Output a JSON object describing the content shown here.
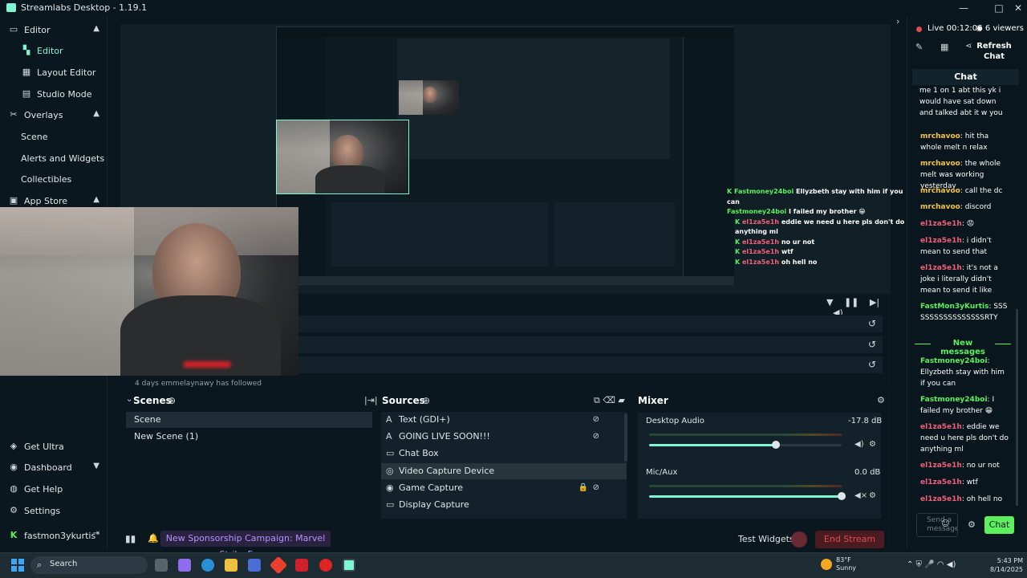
{
  "window": {
    "title": "Streamlabs Desktop - 1.19.1"
  },
  "sidebar": {
    "sections": [
      {
        "label": "Editor",
        "icon": "editor-icon",
        "children": [
          "Editor",
          "Layout Editor",
          "Studio Mode"
        ]
      },
      {
        "label": "Overlays",
        "icon": "overlays-icon",
        "children": [
          "Scene",
          "Alerts and Widgets",
          "Collectibles"
        ]
      },
      {
        "label": "App Store",
        "icon": "app-store-icon"
      }
    ],
    "bottom": [
      "Get Ultra",
      "Dashboard",
      "Get Help",
      "Settings"
    ],
    "user": "fastmon3ykurtis"
  },
  "events": {
    "follow_text": "4 days   emmelaynawy   has followed"
  },
  "scenes": {
    "title": "Scenes",
    "items": [
      "Scene",
      "New Scene (1)"
    ]
  },
  "sources": {
    "title": "Sources",
    "items": [
      "Text (GDI+)",
      "GOING LIVE SOON!!!",
      "Chat Box",
      "Video Capture Device",
      "Game Capture",
      "Display Capture"
    ]
  },
  "mixer": {
    "title": "Mixer",
    "channels": [
      {
        "name": "Desktop Audio",
        "db": "-17.8 dB",
        "level": 0.66
      },
      {
        "name": "Mic/Aux",
        "db": "0.0 dB",
        "level": 1.0
      }
    ]
  },
  "bottombar": {
    "promo": "New Sponsorship Campaign: Marvel Strike Force",
    "test_widgets": "Test Widgets",
    "end_stream": "End Stream"
  },
  "live": {
    "status": "Live",
    "time": "00:12:06",
    "viewers": "6 viewers",
    "refresh": "Refresh Chat"
  },
  "chat": {
    "title": "Chat",
    "cut_top": "me 1 on 1 abt this yk i would have sat down and talked abt it w you",
    "messages": [
      {
        "user": "mrchavoo",
        "text": "hit tha whole melt n relax",
        "color": "y"
      },
      {
        "user": "mrchavoo",
        "text": "the whole melt was working yesterday",
        "color": "y"
      },
      {
        "user": "mrchavoo",
        "text": "call the dc",
        "color": "y"
      },
      {
        "user": "mrchavoo",
        "text": "discord",
        "color": "y"
      },
      {
        "user": "el1za5e1h",
        "text": "😡",
        "color": "r"
      },
      {
        "user": "el1za5e1h",
        "text": "i didn't mean to send that",
        "color": "r"
      },
      {
        "user": "el1za5e1h",
        "text": "it's not a joke i literally didn't mean to send it like",
        "color": "r"
      },
      {
        "user": "FastMon3yKurtis",
        "text": "SSSSSSSSSSSSSSSSSRTY",
        "color": "g"
      }
    ],
    "new_label": "New messages",
    "new_messages": [
      {
        "user": "Fastmoney24boi",
        "text": "Ellyzbeth stay with him if you can",
        "color": "g"
      },
      {
        "user": "Fastmoney24boi",
        "text": "I failed my brother 😁",
        "color": "g"
      },
      {
        "user": "el1za5e1h",
        "text": "eddie we need u here pls don't do anything ml",
        "color": "r"
      },
      {
        "user": "el1za5e1h",
        "text": "no ur not",
        "color": "r"
      },
      {
        "user": "el1za5e1h",
        "text": "wtf",
        "color": "r"
      },
      {
        "user": "el1za5e1h",
        "text": "oh hell no",
        "color": "r"
      }
    ],
    "input_placeholder": "Send a message",
    "send": "Chat"
  },
  "overlay_chat": [
    {
      "user": "Fastmoney24boi",
      "text": "Ellyzbeth stay with him if you can"
    },
    {
      "user": "Fastmoney24boi",
      "text": "I failed my brother 😁"
    },
    {
      "user": "el1za5e1h",
      "text": "eddie we need u here pls don't do anything ml"
    },
    {
      "user": "el1za5e1h",
      "text": "no ur not"
    },
    {
      "user": "el1za5e1h",
      "text": "wtf"
    },
    {
      "user": "el1za5e1h",
      "text": "oh hell no"
    }
  ],
  "taskbar": {
    "search": "Search",
    "weather_temp": "83°F",
    "weather_desc": "Sunny",
    "time": "5:43 PM",
    "date": "8/14/2025"
  },
  "colors": {
    "accent": "#80f5d2",
    "end_stream": "#e24a4a",
    "chat_btn": "#5cf05c"
  }
}
